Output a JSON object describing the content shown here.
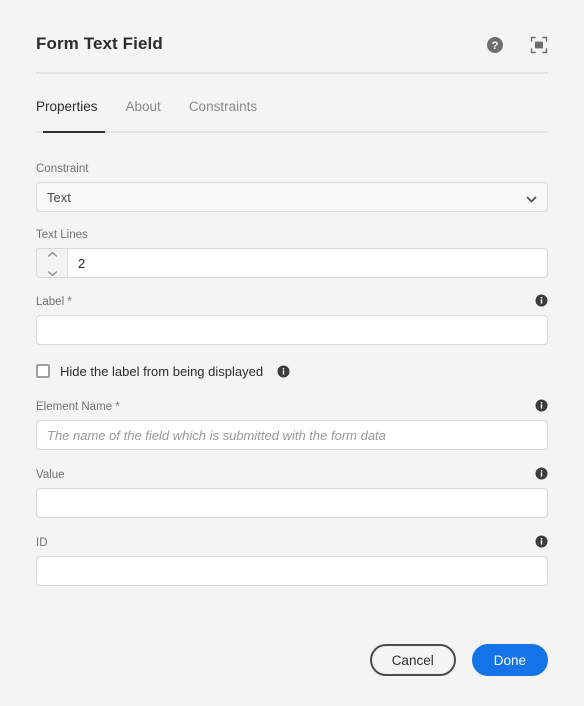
{
  "header": {
    "title": "Form Text Field",
    "help_icon": "help-circle-icon",
    "fullscreen_icon": "fullscreen-icon"
  },
  "tabs": [
    {
      "label": "Properties",
      "active": true
    },
    {
      "label": "About",
      "active": false
    },
    {
      "label": "Constraints",
      "active": false
    }
  ],
  "form": {
    "constraint": {
      "label": "Constraint",
      "value": "Text",
      "chevron_icon": "chevron-down-icon"
    },
    "text_lines": {
      "label": "Text Lines",
      "value": "2",
      "placeholder": "",
      "increment_icon": "chevron-up-icon",
      "decrement_icon": "chevron-down-icon"
    },
    "label_field": {
      "label": "Label *",
      "value": "",
      "placeholder": "",
      "info_icon": "info-icon"
    },
    "hide_label": {
      "label": "Hide the label from being displayed",
      "checked": false,
      "info_icon": "info-icon"
    },
    "element_name": {
      "label": "Element Name *",
      "value": "",
      "placeholder": "The name of the field which is submitted with the form data",
      "info_icon": "info-icon"
    },
    "value_field": {
      "label": "Value",
      "value": "",
      "placeholder": "",
      "info_icon": "info-icon"
    },
    "id_field": {
      "label": "ID",
      "value": "",
      "placeholder": "",
      "info_icon": "info-icon"
    }
  },
  "footer": {
    "cancel_label": "Cancel",
    "done_label": "Done"
  },
  "colors": {
    "accent": "#1473e6",
    "page_background": "#f4f4f4",
    "text_primary": "#2c2c2c",
    "text_secondary": "#707070",
    "border": "#d8d8d8"
  }
}
